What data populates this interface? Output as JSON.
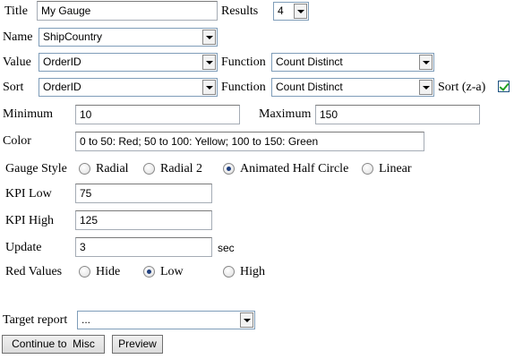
{
  "title_row": {
    "title_label": "Title",
    "title_value": "My Gauge",
    "results_label": "Results",
    "results_value": "4"
  },
  "name_row": {
    "label": "Name",
    "value": "ShipCountry"
  },
  "value_row": {
    "label": "Value",
    "value": "OrderID",
    "function_label": "Function",
    "function_value": "Count Distinct"
  },
  "sort_row": {
    "label": "Sort",
    "value": "OrderID",
    "function_label": "Function",
    "function_value": "Count Distinct",
    "sort_za_label": "Sort (z-a)",
    "sort_za_checked": true
  },
  "range_row": {
    "min_label": "Minimum",
    "min_value": "10",
    "max_label": "Maximum",
    "max_value": "150"
  },
  "color_row": {
    "label": "Color",
    "value": "0 to 50: Red; 50 to 100: Yellow; 100 to 150: Green"
  },
  "gauge_style": {
    "label": "Gauge Style",
    "options": [
      "Radial",
      "Radial 2",
      "Animated Half Circle",
      "Linear"
    ],
    "selected": "Animated Half Circle"
  },
  "kpi": {
    "low_label": "KPI Low",
    "low_value": "75",
    "high_label": "KPI High",
    "high_value": "125"
  },
  "update": {
    "label": "Update",
    "value": "3",
    "unit": "sec"
  },
  "red_values": {
    "label": "Red Values",
    "options": [
      "Hide",
      "Low",
      "High"
    ],
    "selected": "Low"
  },
  "target_report": {
    "label": "Target report",
    "value": "..."
  },
  "buttons": {
    "continue": "Continue to  Misc",
    "preview": "Preview"
  }
}
